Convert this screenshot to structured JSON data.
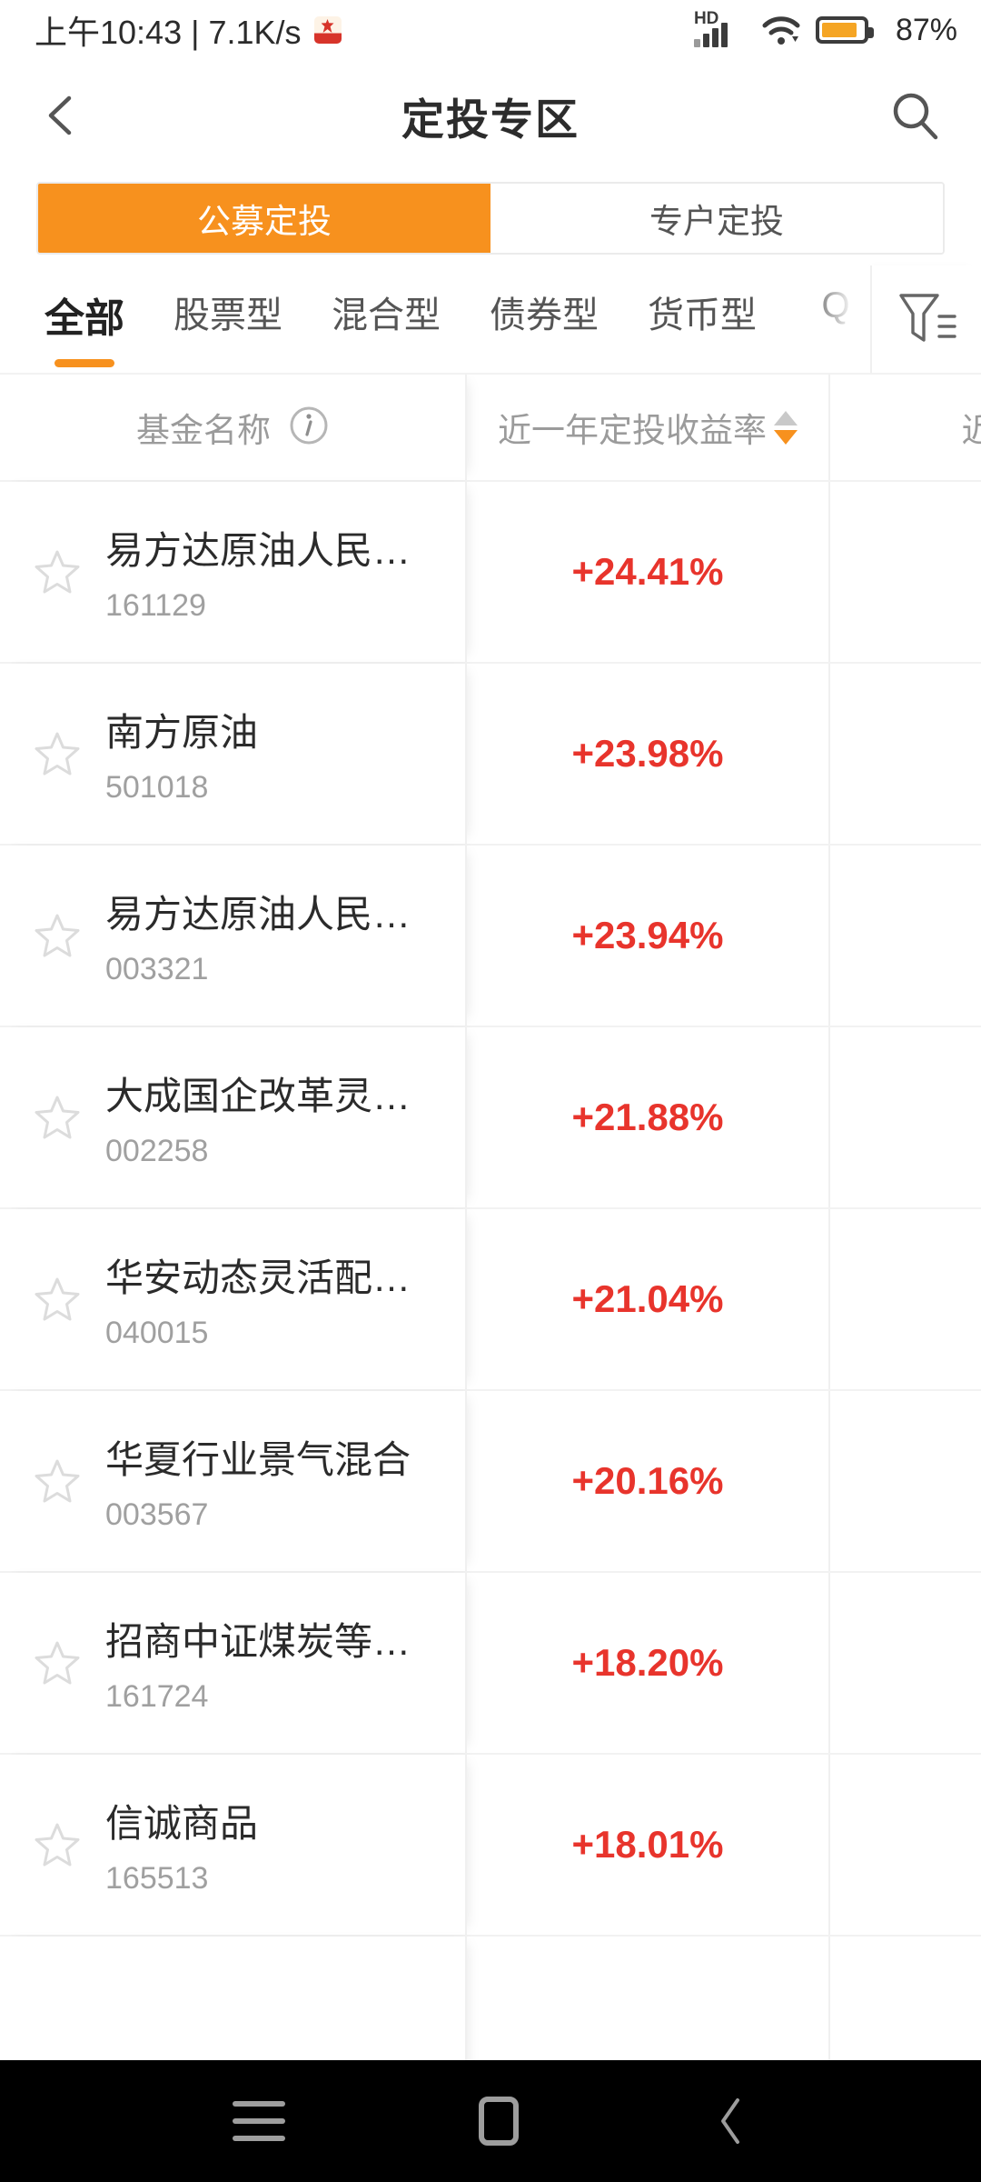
{
  "statusbar": {
    "clock": "上午10:43 | 7.1K/s",
    "app_icon": "notification-app-icon",
    "hd_label": "HD",
    "signal_icon": "signal-bars-icon",
    "wifi_icon": "wifi-icon",
    "battery_icon": "battery-icon",
    "battery_percent": "87%",
    "battery_level": 87,
    "battery_color": "#f5a524"
  },
  "header": {
    "back_icon": "back-chevron-icon",
    "title": "定投专区",
    "search_icon": "search-icon"
  },
  "segmented": {
    "items": [
      {
        "label": "公募定投",
        "active": true
      },
      {
        "label": "专户定投",
        "active": false
      }
    ],
    "active_color": "#f7911e"
  },
  "category_tabs": {
    "items": [
      {
        "label": "全部",
        "active": true
      },
      {
        "label": "股票型",
        "active": false
      },
      {
        "label": "混合型",
        "active": false
      },
      {
        "label": "债券型",
        "active": false
      },
      {
        "label": "货币型",
        "active": false
      },
      {
        "label": "Q",
        "active": false,
        "clipped": true
      }
    ],
    "underline_color": "#f7911e",
    "filter_icon": "filter-funnel-icon"
  },
  "table": {
    "columns": [
      {
        "label": "基金名称",
        "icon": "info-circle-icon",
        "sortable": false
      },
      {
        "label": "近一年定投收益率",
        "sortable": true,
        "sort": "desc"
      },
      {
        "label": "近三年",
        "sortable": true,
        "sort": "none",
        "clipped": true
      }
    ],
    "favorite_icon": "star-outline-icon",
    "positive_color": "#e8342c",
    "rows": [
      {
        "name": "易方达原油人民…",
        "code": "161129",
        "return_1y": "+24.41%",
        "return_3y": "+"
      },
      {
        "name": "南方原油",
        "code": "501018",
        "return_1y": "+23.98%",
        "return_3y": "+"
      },
      {
        "name": "易方达原油人民…",
        "code": "003321",
        "return_1y": "+23.94%",
        "return_3y": "+"
      },
      {
        "name": "大成国企改革灵…",
        "code": "002258",
        "return_1y": "+21.88%",
        "return_3y": "+"
      },
      {
        "name": "华安动态灵活配…",
        "code": "040015",
        "return_1y": "+21.04%",
        "return_3y": "+"
      },
      {
        "name": "华夏行业景气混合",
        "code": "003567",
        "return_1y": "+20.16%",
        "return_3y": "+"
      },
      {
        "name": "招商中证煤炭等…",
        "code": "161724",
        "return_1y": "+18.20%",
        "return_3y": "+"
      },
      {
        "name": "信诚商品",
        "code": "165513",
        "return_1y": "+18.01%",
        "return_3y": "+"
      }
    ]
  },
  "navbar": {
    "recents_icon": "recents-menu-icon",
    "home_icon": "home-square-icon",
    "back_icon": "nav-back-chevron-icon"
  }
}
